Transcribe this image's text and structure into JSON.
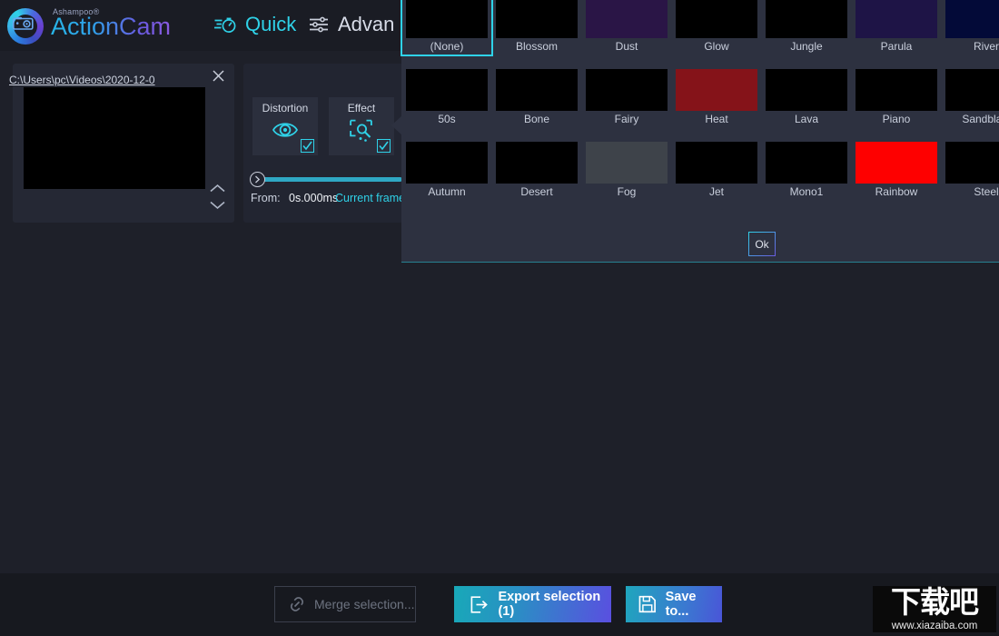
{
  "app": {
    "brand_small": "Ashampoo®",
    "brand_main": "ActionCam",
    "logo_icon": "action-camera-icon"
  },
  "header": {
    "tabs": [
      {
        "label": "Quick",
        "icon": "stopwatch-icon",
        "active": true
      },
      {
        "label": "Advan",
        "icon": "sliders-icon",
        "active": false
      }
    ]
  },
  "clip_panel": {
    "close_icon": "close-icon",
    "up_icon": "chevron-up-icon",
    "down_icon": "chevron-down-icon",
    "thumbnail_color": "#000000"
  },
  "settings_panel": {
    "file_path": "C:\\Users\\pc\\Videos\\2020-12-0",
    "tools": [
      {
        "label": "Distortion",
        "icon": "eye-distortion-icon",
        "checked": true
      },
      {
        "label": "Effect",
        "icon": "effect-wand-icon",
        "checked": true
      }
    ],
    "slider": {
      "knob_icon": "chevron-right-icon",
      "value_percent": 0
    },
    "from_label": "From:",
    "from_value": "0s.000ms",
    "current_frame_link": "Current frame"
  },
  "effect_popup": {
    "ok_label": "Ok",
    "selected": "(None)",
    "columns": 7,
    "effects": [
      {
        "name": "(None)",
        "color": "#000000",
        "selected": true
      },
      {
        "name": "Blossom",
        "color": "#000000"
      },
      {
        "name": "Dust",
        "color": "#2a1546"
      },
      {
        "name": "Glow",
        "color": "#000000"
      },
      {
        "name": "Jungle",
        "color": "#000000"
      },
      {
        "name": "Parula",
        "color": "#1e1446"
      },
      {
        "name": "River",
        "color": "#030a38"
      },
      {
        "name": "50s",
        "color": "#000000"
      },
      {
        "name": "Bone",
        "color": "#000000"
      },
      {
        "name": "Fairy",
        "color": "#000000"
      },
      {
        "name": "Heat",
        "color": "#851319"
      },
      {
        "name": "Lava",
        "color": "#000000"
      },
      {
        "name": "Piano",
        "color": "#000000"
      },
      {
        "name": "Sandblast",
        "color": "#000000"
      },
      {
        "name": "Autumn",
        "color": "#000000"
      },
      {
        "name": "Desert",
        "color": "#000000"
      },
      {
        "name": "Fog",
        "color": "#3e434a"
      },
      {
        "name": "Jet",
        "color": "#000000"
      },
      {
        "name": "Mono1",
        "color": "#000000"
      },
      {
        "name": "Rainbow",
        "color": "#fe0000"
      },
      {
        "name": "Steel",
        "color": "#000000"
      }
    ]
  },
  "bottom_bar": {
    "merge_label": "Merge selection...",
    "merge_icon": "link-icon",
    "export_label": "Export selection (1)",
    "export_icon": "export-arrow-icon",
    "save_label": "Save to...",
    "save_icon": "floppy-disk-icon"
  },
  "watermark": {
    "text_cn": "下载吧",
    "url": "www.xiazaiba.com"
  },
  "colors": {
    "background": "#1e2029",
    "header": "#1a1c24",
    "panel": "#252834",
    "popup": "#2d3140",
    "accent_cyan": "#2fd2e8",
    "accent_purple": "#6a5ae0",
    "bottom_bar": "#17191f"
  }
}
